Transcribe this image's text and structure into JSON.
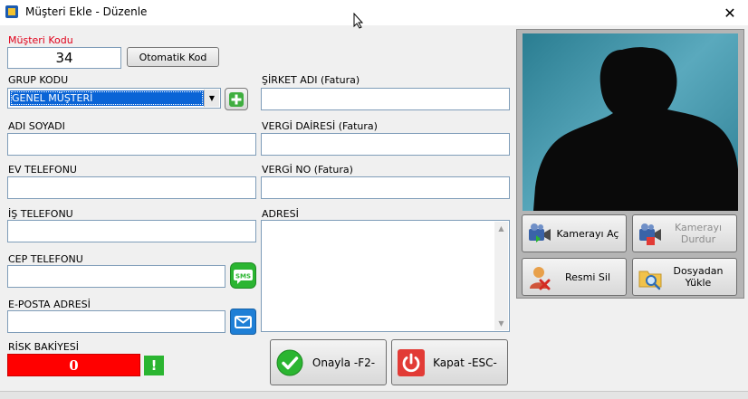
{
  "window": {
    "title": "Müşteri Ekle - Düzenle",
    "close_symbol": "✕"
  },
  "form": {
    "customer_code": {
      "label": "Müşteri Kodu",
      "value": "34"
    },
    "auto_code_button": "Otomatik Kod",
    "group_code": {
      "label": "GRUP KODU",
      "selected": "GENEL MÜŞTERİ"
    },
    "company_name": {
      "label": "ŞİRKET ADI (Fatura)",
      "value": ""
    },
    "full_name": {
      "label": "ADI SOYADI",
      "value": ""
    },
    "tax_office": {
      "label": "VERGİ DAİRESİ (Fatura)",
      "value": ""
    },
    "home_phone": {
      "label": "EV TELEFONU",
      "value": ""
    },
    "tax_number": {
      "label": "VERGİ NO (Fatura)",
      "value": ""
    },
    "work_phone": {
      "label": "İŞ TELEFONU",
      "value": ""
    },
    "address": {
      "label": "ADRESİ",
      "value": ""
    },
    "mobile_phone": {
      "label": "CEP TELEFONU",
      "value": ""
    },
    "sms_label": "SMS",
    "email": {
      "label": "E-POSTA ADRESİ",
      "value": ""
    },
    "risk_balance": {
      "label": "RİSK BAKİYESİ",
      "value": "0"
    },
    "risk_alert": "!"
  },
  "actions": {
    "approve": "Onayla -F2-",
    "close": "Kapat -ESC-"
  },
  "camera_panel": {
    "open_camera": "Kamerayı Aç",
    "stop_camera_line1": "Kamerayı",
    "stop_camera_line2": "Durdur",
    "delete_photo": "Resmi Sil",
    "upload_line1": "Dosyadan",
    "upload_line2": "Yükle"
  },
  "colors": {
    "selection": "#0a64d6",
    "risk_red": "#ff0000",
    "accent_green": "#2bb531",
    "label_red": "#e0001a"
  }
}
